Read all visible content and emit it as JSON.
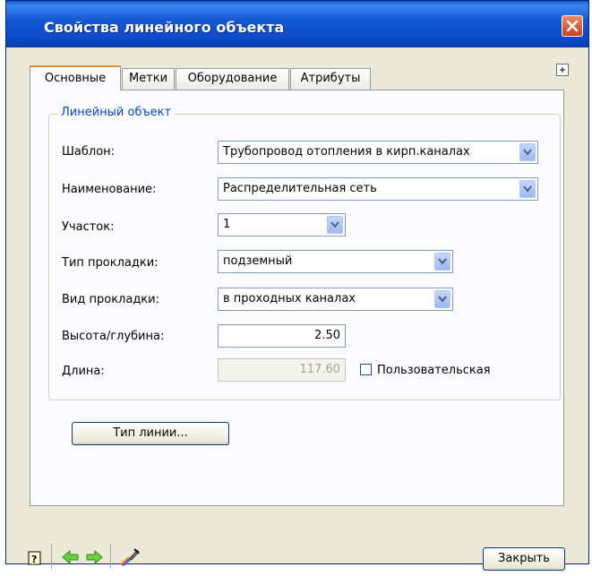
{
  "window": {
    "title": "Свойства линейного объекта"
  },
  "tabs": [
    {
      "label": "Основные"
    },
    {
      "label": "Метки"
    },
    {
      "label": "Оборудование"
    },
    {
      "label": "Атрибуты"
    }
  ],
  "group": {
    "legend": "Линейный объект"
  },
  "fields": {
    "template": {
      "label": "Шаблон:",
      "value": "Трубопровод отопления в кирп.каналах"
    },
    "name": {
      "label": "Наименование:",
      "value": "Распределительная сеть"
    },
    "section": {
      "label": "Участок:",
      "value": "1"
    },
    "laying_type": {
      "label": "Тип прокладки:",
      "value": "подземный"
    },
    "laying_kind": {
      "label": "Вид прокладки:",
      "value": "в проходных каналах"
    },
    "height": {
      "label": "Высота/глубина:",
      "value": "2.50"
    },
    "length": {
      "label": "Длина:",
      "value": "117.60",
      "custom_label": "Пользовательская",
      "custom_checked": false
    }
  },
  "buttons": {
    "line_type": "Тип линии...",
    "close": "Закрыть"
  },
  "icons": [
    "help-icon",
    "back-arrow-icon",
    "forward-arrow-icon",
    "properties-brush-icon",
    "expand-icon",
    "close-icon",
    "chevron-down-icon"
  ],
  "colors": {
    "title_bar": "#0b49c8",
    "tab_highlight": "#e68b2c",
    "legend_text": "#0046d5",
    "arrow_green": "#3fae2a"
  }
}
